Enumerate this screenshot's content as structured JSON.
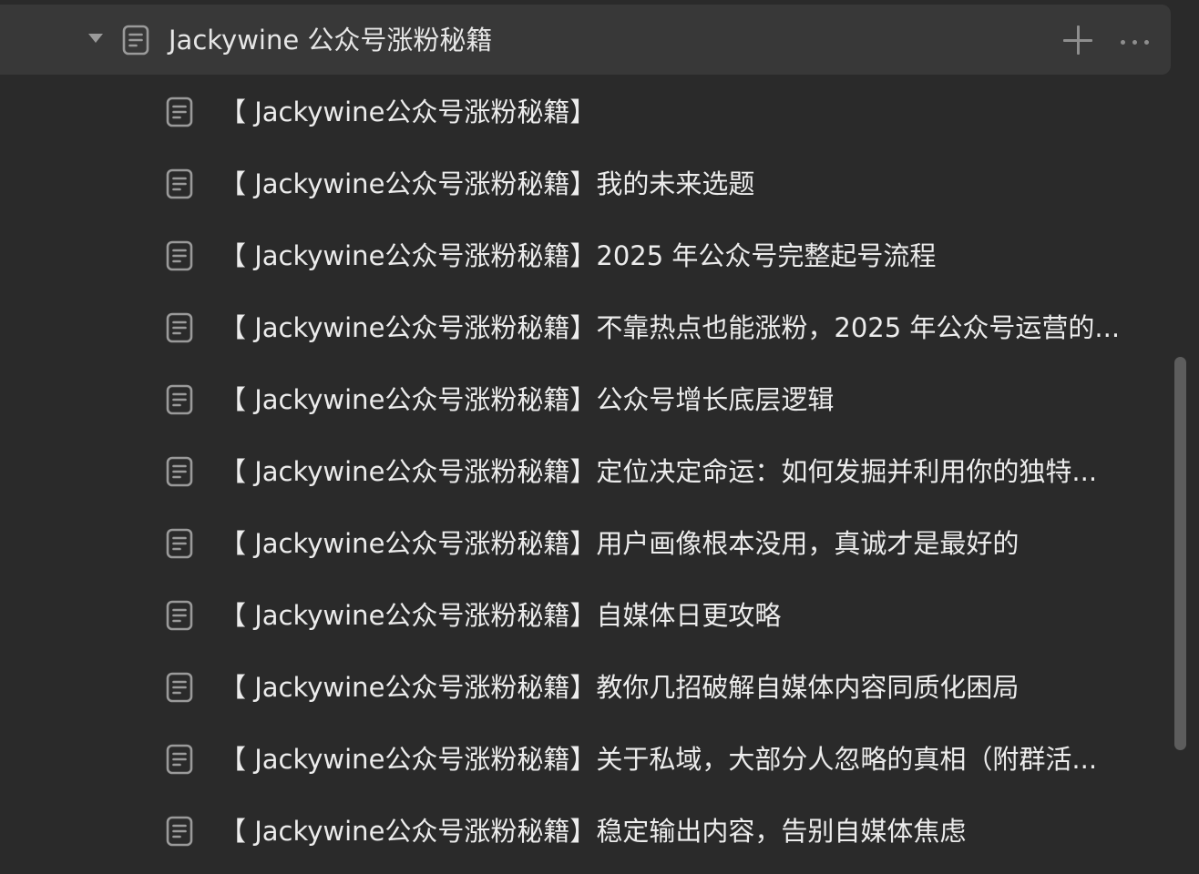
{
  "parent": {
    "title": "Jackywine 公众号涨粉秘籍",
    "caret_icon": "caret-down-icon",
    "page_icon": "document-icon",
    "add_icon": "plus-icon",
    "more_icon": "more-horizontal-icon"
  },
  "children": [
    {
      "title": "【 Jackywine公众号涨粉秘籍】"
    },
    {
      "title": "【 Jackywine公众号涨粉秘籍】我的未来选题"
    },
    {
      "title": "【 Jackywine公众号涨粉秘籍】2025 年公众号完整起号流程"
    },
    {
      "title": "【 Jackywine公众号涨粉秘籍】不靠热点也能涨粉，2025 年公众号运营的..."
    },
    {
      "title": "【 Jackywine公众号涨粉秘籍】公众号增长底层逻辑"
    },
    {
      "title": "【 Jackywine公众号涨粉秘籍】定位决定命运：如何发掘并利用你的独特..."
    },
    {
      "title": "【 Jackywine公众号涨粉秘籍】用户画像根本没用，真诚才是最好的"
    },
    {
      "title": "【 Jackywine公众号涨粉秘籍】自媒体日更攻略"
    },
    {
      "title": "【 Jackywine公众号涨粉秘籍】教你几招破解自媒体内容同质化困局"
    },
    {
      "title": "【 Jackywine公众号涨粉秘籍】关于私域，大部分人忽略的真相（附群活..."
    },
    {
      "title": "【 Jackywine公众号涨粉秘籍】稳定输出内容，告别自媒体焦虑"
    }
  ],
  "colors": {
    "background": "#2a2a2a",
    "parent_row_background": "#383838",
    "text": "#ececec",
    "icon": "#9a9a9a",
    "scrollbar": "#5d5d5d"
  }
}
